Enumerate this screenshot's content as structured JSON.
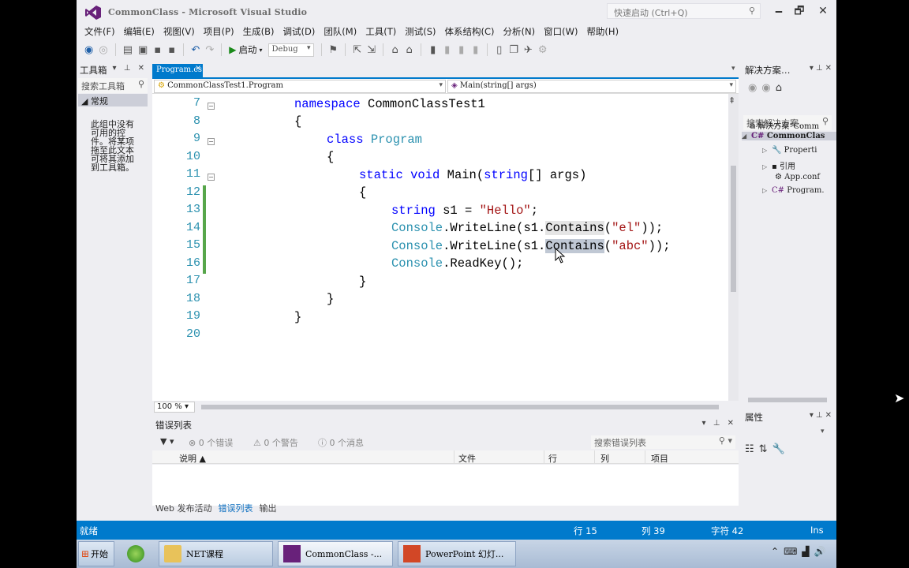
{
  "window": {
    "title": "CommonClass - Microsoft Visual Studio",
    "quick_launch_placeholder": "快速启动 (Ctrl+Q)",
    "controls": {
      "minimize": "🗕",
      "maximize": "🗗",
      "close": "✕"
    }
  },
  "menu": [
    "文件(F)",
    "编辑(E)",
    "视图(V)",
    "项目(P)",
    "生成(B)",
    "调试(D)",
    "团队(M)",
    "工具(T)",
    "测试(S)",
    "体系结构(C)",
    "分析(N)",
    "窗口(W)",
    "帮助(H)"
  ],
  "toolbar": {
    "start_label": "启动",
    "config": "Debug"
  },
  "toolbox": {
    "title": "工具箱",
    "search_placeholder": "搜索工具箱",
    "category": "◢ 常规",
    "empty_message": "此组中没有可用的控件。将某项拖至此文本可将其添加到工具箱。"
  },
  "editor": {
    "tab_label": "Program.cs",
    "tab_close": "×",
    "nav_left": "CommonClassTest1.Program",
    "nav_right": "Main(string[] args)",
    "zoom": "100 %",
    "line_numbers": [
      "7",
      "8",
      "9",
      "10",
      "11",
      "12",
      "13",
      "14",
      "15",
      "16",
      "17",
      "18",
      "19",
      "20"
    ],
    "code": {
      "l7_kw": "namespace",
      "l7_name": " CommonClassTest1",
      "l8": "{",
      "l9_kw": "class",
      "l9_type": "Program",
      "l10": "{",
      "l11_kw1": "static",
      "l11_kw2": "void",
      "l11_main": " Main(",
      "l11_kw3": "string",
      "l11_rest": "[] args)",
      "l12": "{",
      "l13_kw": "string",
      "l13_mid": " s1 = ",
      "l13_str": "\"Hello\"",
      "l13_end": ";",
      "l14_type": "Console",
      "l14_a": ".WriteLine(s1.",
      "l14_contains": "Contains",
      "l14_b": "(",
      "l14_str": "\"el\"",
      "l14_c": "));",
      "l15_type": "Console",
      "l15_a": ".WriteLine(s1.",
      "l15_contains": "Contains",
      "l15_b": "(",
      "l15_str": "\"abc\"",
      "l15_c": "));",
      "l16_type": "Console",
      "l16_a": ".ReadKey();",
      "l17": "}",
      "l18": "}",
      "l19": "}"
    }
  },
  "error_list": {
    "title": "错误列表",
    "errors": "0 个错误",
    "warnings": "0 个警告",
    "messages": "0 个消息",
    "search_placeholder": "搜索错误列表",
    "columns": [
      "说明",
      "文件",
      "行",
      "列",
      "项目"
    ]
  },
  "bottom_tabs": [
    "Web 发布活动",
    "错误列表",
    "输出"
  ],
  "solution_explorer": {
    "title": "解决方案…",
    "search_placeholder": "搜索解决方案…",
    "items": [
      "解决方案“Comm",
      "CommonClas",
      "Properti",
      "引用",
      "App.conf",
      "Program."
    ]
  },
  "properties": {
    "title": "属性"
  },
  "statusbar": {
    "ready": "就绪",
    "line": "行 15",
    "col": "列 39",
    "char": "字符 42",
    "mode": "Ins"
  },
  "taskbar": {
    "start": "开始",
    "items": [
      "NET课程",
      "CommonClass -...",
      "PowerPoint 幻灯..."
    ]
  },
  "colors": {
    "accent": "#007acc",
    "keyword": "#0000ff",
    "type": "#2b91af",
    "string": "#a31515"
  }
}
